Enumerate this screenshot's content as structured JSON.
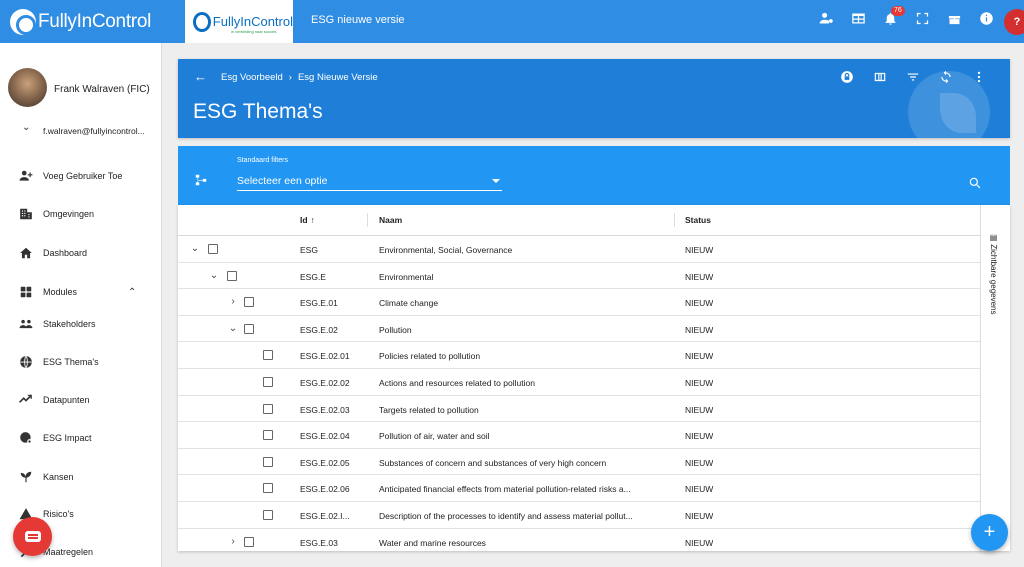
{
  "app": {
    "logo_text": "FullyInControl",
    "tenant_logo_text": "FullyInControl",
    "tenant_logo_sub": "in verbinding naar succes",
    "title": "ESG nieuwe versie"
  },
  "topbar": {
    "notification_count": "76",
    "icons": [
      "user-settings-icon",
      "table-icon",
      "bell-icon",
      "fullscreen-icon",
      "gift-icon",
      "info-icon",
      "help-icon"
    ],
    "help_label": "?"
  },
  "user": {
    "name": "Frank Walraven (FIC)",
    "email": "f.walraven@fullyincontrol..."
  },
  "sidebar": {
    "items": [
      {
        "label": "Voeg Gebruiker Toe",
        "icon": "add-user-icon"
      },
      {
        "label": "Omgevingen",
        "icon": "building-icon"
      },
      {
        "label": "Dashboard",
        "icon": "home-icon"
      },
      {
        "label": "Modules",
        "icon": "modules-icon"
      },
      {
        "label": "Stakeholders",
        "icon": "stakeholders-icon"
      },
      {
        "label": "ESG Thema's",
        "icon": "globe-icon"
      },
      {
        "label": "Datapunten",
        "icon": "chart-line-icon"
      },
      {
        "label": "ESG Impact",
        "icon": "globe-gear-icon"
      },
      {
        "label": "Kansen",
        "icon": "sprout-icon"
      },
      {
        "label": "Risico's",
        "icon": "warning-icon"
      },
      {
        "label": "Maatregelen",
        "icon": "tools-icon"
      }
    ]
  },
  "header": {
    "breadcrumb": [
      "Esg Voorbeeld",
      "Esg Nieuwe Versie"
    ],
    "separator": "›",
    "title": "ESG Thema's"
  },
  "filters": {
    "caption": "Standaard filters",
    "select_value": "Selecteer een optie"
  },
  "table": {
    "columns": {
      "id": "Id",
      "name": "Naam",
      "status": "Status"
    },
    "sort_indicator": "↑",
    "side_panel_label": "Zichtbare gegevens",
    "rows": [
      {
        "id": "ESG",
        "name": "Environmental, Social, Governance",
        "status": "NIEUW",
        "level": 0,
        "expander": "⌄"
      },
      {
        "id": "ESG.E",
        "name": "Environmental",
        "status": "NIEUW",
        "level": 1,
        "expander": "⌄"
      },
      {
        "id": "ESG.E.01",
        "name": "Climate change",
        "status": "NIEUW",
        "level": 2,
        "expander": "›"
      },
      {
        "id": "ESG.E.02",
        "name": "Pollution",
        "status": "NIEUW",
        "level": 2,
        "expander": "⌄"
      },
      {
        "id": "ESG.E.02.01",
        "name": "Policies related to pollution",
        "status": "NIEUW",
        "level": 3,
        "expander": ""
      },
      {
        "id": "ESG.E.02.02",
        "name": "Actions and resources related to pollution",
        "status": "NIEUW",
        "level": 3,
        "expander": ""
      },
      {
        "id": "ESG.E.02.03",
        "name": "Targets related to pollution",
        "status": "NIEUW",
        "level": 3,
        "expander": ""
      },
      {
        "id": "ESG.E.02.04",
        "name": "Pollution of air, water and soil",
        "status": "NIEUW",
        "level": 3,
        "expander": ""
      },
      {
        "id": "ESG.E.02.05",
        "name": "Substances of concern and substances of very high concern",
        "status": "NIEUW",
        "level": 3,
        "expander": ""
      },
      {
        "id": "ESG.E.02.06",
        "name": "Anticipated financial effects from material pollution-related risks a...",
        "status": "NIEUW",
        "level": 3,
        "expander": ""
      },
      {
        "id": "ESG.E.02.I...",
        "name": "Description of the processes to identify and assess material pollut...",
        "status": "NIEUW",
        "level": 3,
        "expander": ""
      },
      {
        "id": "ESG.E.03",
        "name": "Water and marine resources",
        "status": "NIEUW",
        "level": 2,
        "expander": "›"
      }
    ]
  },
  "fab": {
    "add_label": "+"
  }
}
